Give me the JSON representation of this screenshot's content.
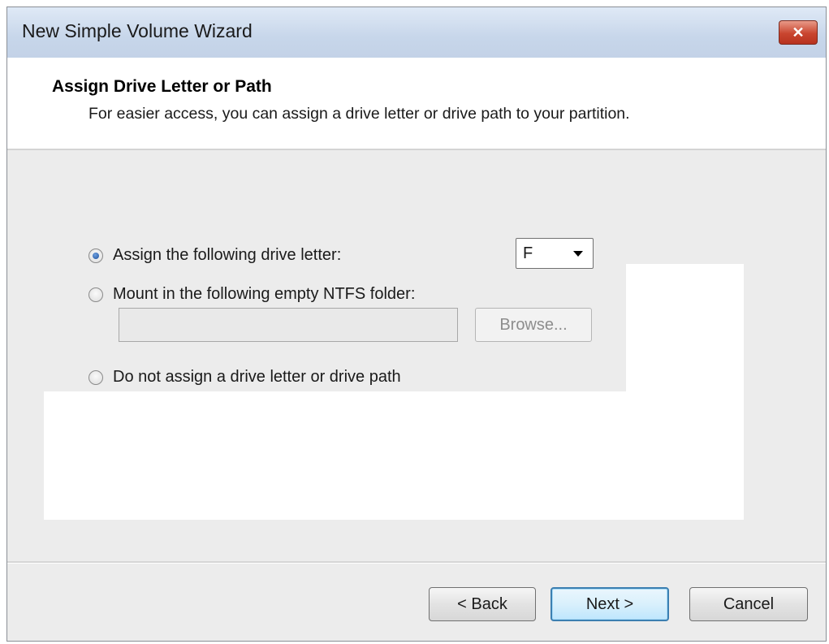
{
  "window": {
    "title": "New Simple Volume Wizard"
  },
  "header": {
    "title": "Assign Drive Letter or Path",
    "subtitle": "For easier access, you can assign a drive letter or drive path to your partition."
  },
  "options": {
    "assign_letter": {
      "label": "Assign the following drive letter:",
      "checked": true
    },
    "drive_letter": {
      "selected": "F"
    },
    "mount_folder": {
      "label": "Mount in the following empty NTFS folder:",
      "checked": false
    },
    "folder_path": {
      "value": ""
    },
    "browse": {
      "label": "Browse..."
    },
    "no_assign": {
      "label": "Do not assign a drive letter or drive path",
      "checked": false
    }
  },
  "footer": {
    "back_label": "< Back",
    "next_label": "Next >",
    "cancel_label": "Cancel"
  },
  "icons": {
    "close": "close-icon",
    "dropdown": "chevron-down-icon"
  }
}
